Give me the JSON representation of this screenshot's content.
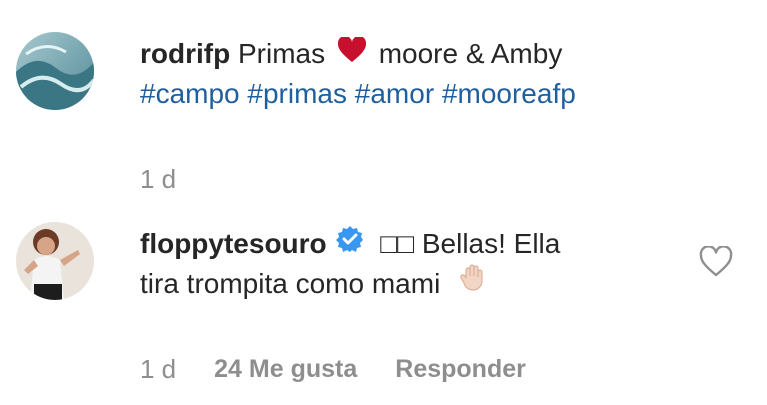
{
  "comments": [
    {
      "username": "rodrifp",
      "text_before_heart": "Primas",
      "text_after_heart": "moore & Amby",
      "hashtags": [
        "#campo",
        "#primas",
        "#amor",
        "#mooreafp"
      ],
      "time": "1 d",
      "avatar_icon": "avatar-image",
      "heart_icon": "red-heart-icon",
      "heart_color": "#c8102e"
    },
    {
      "username": "floppytesouro",
      "verified_icon": "verified-badge-icon",
      "verified_color": "#3897f0",
      "text_line1": "Bellas! Ella",
      "missing_glyphs": "□□",
      "text_line2": "tira trompita como mami",
      "emoji_icon": "raised-hand-emoji-icon",
      "time": "1 d",
      "likes": "24 Me gusta",
      "reply": "Responder",
      "like_icon": "heart-outline-icon"
    }
  ]
}
